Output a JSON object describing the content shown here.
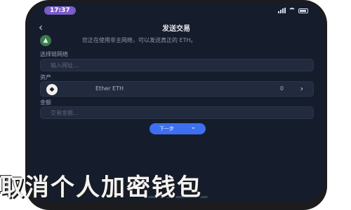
{
  "status_bar": {
    "time": "17:37"
  },
  "nav": {
    "back_icon": "chevron-left-icon",
    "title": "发送交易"
  },
  "banner": {
    "icon": "warning-icon",
    "text": "您正在使用非主网络，可以发送真正的 ETH。"
  },
  "network_section": {
    "label": "选择链网络",
    "placeholder": "输入网址..."
  },
  "account_section": {
    "label": "资产"
  },
  "asset": {
    "icon": "ethereum-icon",
    "name": "Ether  ETH",
    "amount": "0"
  },
  "amount_section": {
    "label": "金额",
    "placeholder": "交易金额..."
  },
  "next_button": {
    "label": "下一步",
    "icon": "chevron-down-icon"
  },
  "caption": "取消个人加密钱包"
}
